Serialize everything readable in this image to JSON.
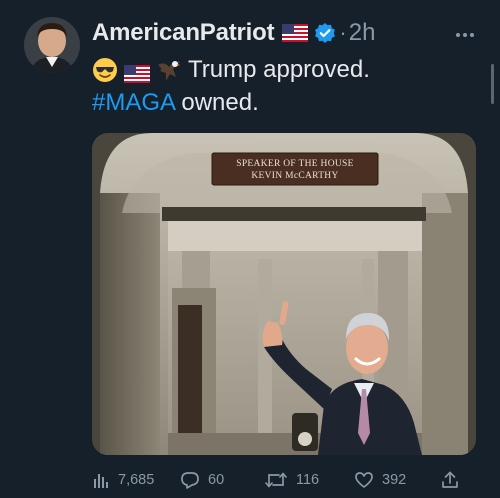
{
  "tweet": {
    "display_name": "AmericanPatriot",
    "separator": "·",
    "time": "2h",
    "text_line1": "Trump approved.",
    "hashtag": "#MAGA",
    "text_line2_rest": " owned.",
    "image": {
      "sign_line1": "SPEAKER OF THE HOUSE",
      "sign_line2": "KEVIN McCARTHY"
    }
  },
  "metrics": {
    "views": "7,685",
    "replies": "60",
    "retweets": "116",
    "likes": "392"
  },
  "colors": {
    "background": "#15202b",
    "text": "#e7e9ea",
    "muted": "#8b98a5",
    "accent": "#1d9bf0"
  },
  "icons": {
    "verified": "verified-badge-icon",
    "flag": "us-flag-icon",
    "more": "more-options-icon",
    "views": "views-bar-chart-icon",
    "reply": "reply-bubble-icon",
    "retweet": "retweet-icon",
    "like": "heart-icon",
    "share": "share-icon"
  }
}
